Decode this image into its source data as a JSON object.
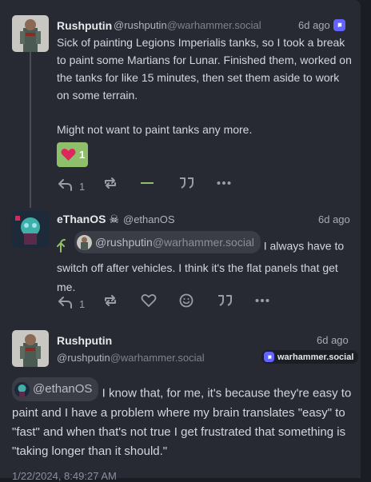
{
  "post1": {
    "display_name": "Rushputin",
    "handle_user": "@rushputin",
    "handle_instance": "@warhammer.social",
    "time": "6d ago",
    "paragraph1": "Sick of painting Legions Imperialis tanks, so I took a break to paint some Martians for Lunar.  Finished them, worked on the tanks for like 15 minutes, then set them aside to work on some terrain.",
    "paragraph2": "Might not want to paint tanks any more.",
    "reaction_count": "1",
    "reply_count": "1"
  },
  "post2": {
    "display_name": "eThanOS",
    "name_emoji": "☠",
    "handle": "@ethanOS",
    "time": "6d ago",
    "mention_user": "@rushputin",
    "mention_instance": "@warhammer.social",
    "text_after_mention": " I always have to switch off after vehicles. I think it's the flat panels that get me.",
    "reply_count": "1"
  },
  "post3": {
    "display_name": "Rushputin",
    "handle_user": "@rushputin",
    "handle_instance": "@warhammer.social",
    "time": "6d ago",
    "source_instance": "warhammer.social",
    "mention": "@ethanOS",
    "text_after_mention": " I know that, for me, it's because they're easy to paint and I have a problem where my brain translates \"easy\" to \"fast\" and when that's not true I get frustrated that something is \"taking longer than it should.\"",
    "timestamp": "1/22/2024, 8:49:27 AM"
  },
  "colors": {
    "accent": "#6364ff",
    "reaction_bg": "#8fbf6a",
    "heart": "#e0245e",
    "panel": "#282a33"
  }
}
